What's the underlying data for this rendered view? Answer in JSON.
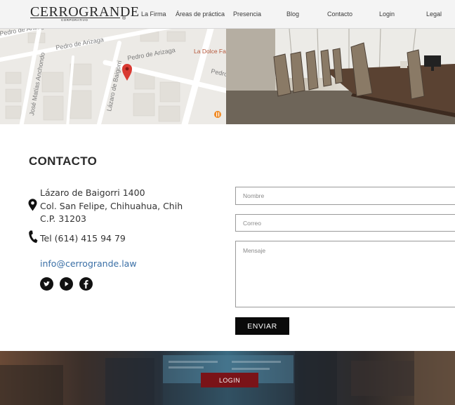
{
  "brand": {
    "name": "CERROGRANDE",
    "tagline": "CORPORATIVO",
    "reg_mark": "®"
  },
  "nav": {
    "items": [
      {
        "label": "La Firma"
      },
      {
        "label": "Áreas de práctica"
      },
      {
        "label": "Presencia"
      },
      {
        "label": "Blog"
      },
      {
        "label": "Contacto"
      },
      {
        "label": "Login"
      },
      {
        "label": "Legal"
      }
    ]
  },
  "map": {
    "streets": [
      {
        "label": "Pedro de Arizaga"
      },
      {
        "label": "Pedro de Arizaga"
      },
      {
        "label": "Pedro de Arizaga"
      },
      {
        "label": "Pedro de"
      },
      {
        "label": "Lázaro de Baigorri"
      },
      {
        "label": "José Matías Anchondo"
      }
    ],
    "poi_label": "La Dolce Farniente",
    "poi_icon": "restaurant-icon",
    "marker_color": "#d93a32"
  },
  "contact": {
    "title": "CONTACTO",
    "address_line1": "Lázaro de Baigorri 1400",
    "address_line2": "Col. San Felipe, Chihuahua, Chih",
    "address_line3": "C.P. 31203",
    "phone": "Tel (614) 415 94 79",
    "email": "info@cerrogrande.law",
    "social": [
      {
        "icon": "twitter-icon"
      },
      {
        "icon": "youtube-icon"
      },
      {
        "icon": "facebook-icon"
      }
    ]
  },
  "form": {
    "name_placeholder": "Nombre",
    "email_placeholder": "Correo",
    "message_placeholder": "Mensaje",
    "submit_label": "ENVIAR"
  },
  "footer": {
    "login_label": "LOGIN"
  },
  "colors": {
    "link": "#3a6fa6",
    "login_button": "#7a1318",
    "submit_button": "#0a0a0a"
  }
}
